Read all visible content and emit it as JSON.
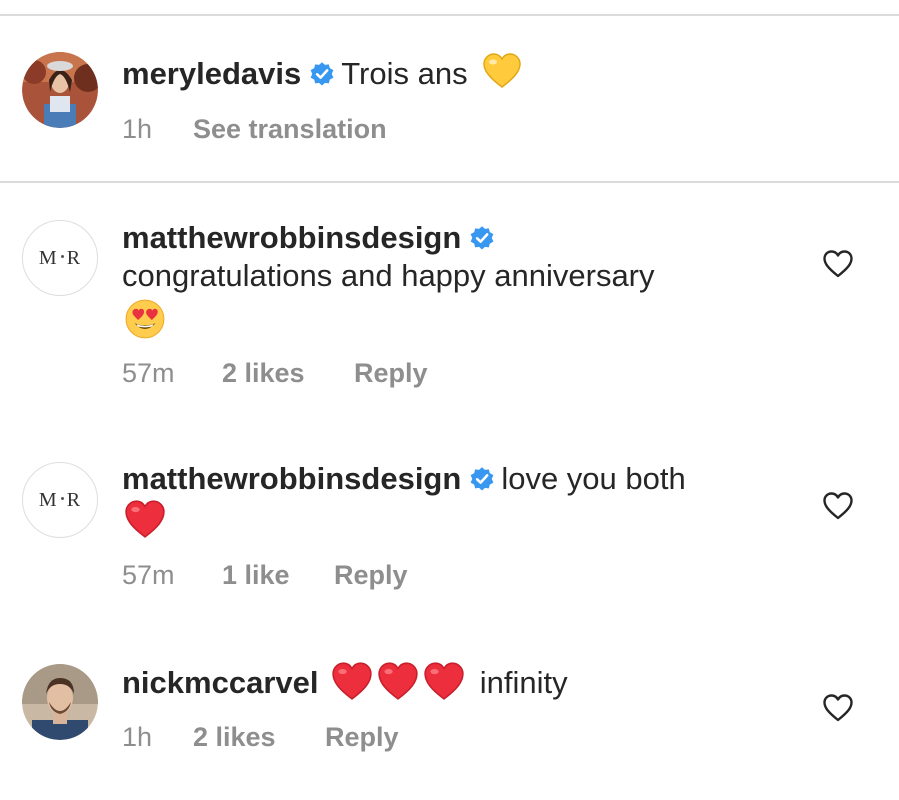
{
  "comments": [
    {
      "username": "meryledavis",
      "verified": true,
      "text": "Trois ans",
      "emoji": [
        "yellow-heart"
      ],
      "time": "1h",
      "action": "See translation"
    },
    {
      "username": "matthewrobbinsdesign",
      "verified": true,
      "text": "congratulations and happy anniversary",
      "emoji": [
        "heart-eyes-face"
      ],
      "time": "57m",
      "likes": "2 likes",
      "reply": "Reply",
      "avatar_text": "M·R"
    },
    {
      "username": "matthewrobbinsdesign",
      "verified": true,
      "text": "love you both",
      "emoji": [
        "red-heart"
      ],
      "time": "57m",
      "likes": "1 like",
      "reply": "Reply",
      "avatar_text": "M·R"
    },
    {
      "username": "nickmccarvel",
      "verified": false,
      "text": "infinity",
      "emoji": [
        "red-heart",
        "red-heart",
        "red-heart"
      ],
      "time": "1h",
      "likes": "2 likes",
      "reply": "Reply"
    }
  ],
  "colors": {
    "text": "#262626",
    "meta": "#8e8e8e",
    "verified": "#3897f0",
    "divider": "#dbdbdb",
    "heart": "#ed2e3c",
    "yellow_heart": "#ffcb3d"
  }
}
